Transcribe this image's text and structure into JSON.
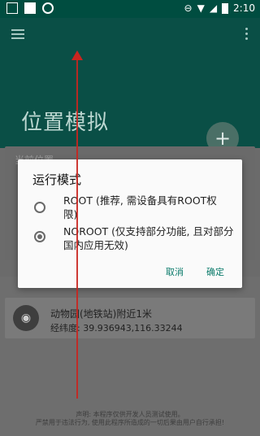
{
  "status_bar": {
    "time": "2:10"
  },
  "page": {
    "title": "位置模拟"
  },
  "card": {
    "header": "当前位置"
  },
  "place": {
    "name": "动物园(地铁站)附近1米",
    "coords": "经纬度: 39.936943,116.33244"
  },
  "footer": {
    "line1": "声明: 本程序仅供开发人员测试使用。",
    "line2": "严禁用于违法行为, 使用此程序所造成的一切后果由用户自行承担!"
  },
  "dialog": {
    "title": "运行模式",
    "options": [
      {
        "label": "ROOT (推荐, 需设备具有ROOT权限)",
        "checked": false
      },
      {
        "label": "NOROOT (仅支持部分功能, 且对部分国内应用无效)",
        "checked": true
      }
    ],
    "cancel": "取消",
    "confirm": "确定"
  },
  "colors": {
    "primary": "#004d40",
    "accent": "#0a7a6a",
    "overlay": "#6b6b6b"
  }
}
